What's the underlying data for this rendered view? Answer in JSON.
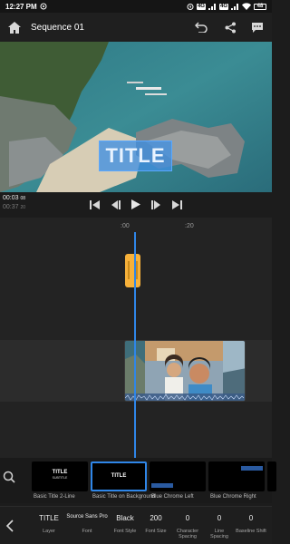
{
  "status": {
    "time": "12:27 PM",
    "battery": "48"
  },
  "topbar": {
    "title": "Sequence 01"
  },
  "preview": {
    "title_text": "TITLE"
  },
  "timecode": {
    "current": "00:03",
    "current_frames": "08",
    "total": "00:37",
    "total_frames": "20"
  },
  "ruler": {
    "marks": [
      ":00",
      ":20"
    ]
  },
  "gallery": {
    "items": [
      {
        "label": "Basic Title 2-Line",
        "thumb_title": "TITLE",
        "thumb_sub": "SUBTITLE",
        "selected": false
      },
      {
        "label": "Basic Title on Background",
        "thumb_title": "TITLE",
        "selected": true
      },
      {
        "label": "Blue Chrome Left",
        "selected": false
      },
      {
        "label": "Blue Chrome Right",
        "selected": false
      }
    ]
  },
  "properties": [
    {
      "value": "TITLE",
      "label": "Layer"
    },
    {
      "value": "Source Sans Pro",
      "label": "Font"
    },
    {
      "value": "Black",
      "label": "Font Style"
    },
    {
      "value": "200",
      "label": "Font Size"
    },
    {
      "value": "0",
      "label": "Character Spacing"
    },
    {
      "value": "0",
      "label": "Line Spacing"
    },
    {
      "value": "0",
      "label": "Baseline Shift"
    }
  ],
  "colors": {
    "accent": "#2f86e8",
    "title_clip": "#f7b13a",
    "overlay": "#4090e1"
  }
}
